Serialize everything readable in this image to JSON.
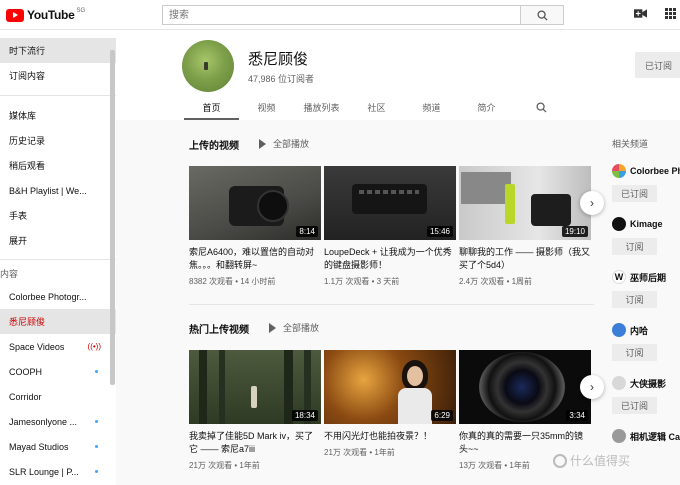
{
  "header": {
    "logo_text": "YouTube",
    "region": "SG",
    "search_placeholder": "搜索"
  },
  "sidebar": {
    "items_top": [
      {
        "label": "时下流行",
        "active": true
      },
      {
        "label": "订阅内容"
      }
    ],
    "items_library": [
      {
        "label": "媒体库"
      },
      {
        "label": "历史记录"
      },
      {
        "label": "稍后观看"
      },
      {
        "label": "B&H Playlist | We..."
      },
      {
        "label": "手表"
      },
      {
        "label": "展开"
      }
    ],
    "subscriptions_heading": "内容",
    "subscriptions": [
      {
        "label": "Colorbee Photogr..."
      },
      {
        "label": "悉尼顾俊"
      },
      {
        "label": "Space Videos"
      },
      {
        "label": "COOPH"
      },
      {
        "label": "Corridor"
      },
      {
        "label": "Jamesonlyone ..."
      },
      {
        "label": "Mayad Studios"
      },
      {
        "label": "SLR Lounge | P..."
      }
    ]
  },
  "channel": {
    "name": "悉尼顾俊",
    "subscribers": "47,986 位订阅者",
    "subscribed_label": "已订阅",
    "tabs": [
      "首页",
      "视频",
      "播放列表",
      "社区",
      "频道",
      "简介"
    ]
  },
  "sections": [
    {
      "title": "上传的视频",
      "play_all": "全部播放",
      "videos": [
        {
          "title": "索尼A6400，难以置信的自动对焦。。。和翻转屏~",
          "meta": "8382 次观看 • 14 小时前",
          "duration": "8:14"
        },
        {
          "title": "LoupeDeck + 让我成为一个优秀的键盘摄影师！",
          "meta": "1.1万 次观看 • 3 天前",
          "duration": "15:46"
        },
        {
          "title": "聊聊我的工作 —— 摄影师（我又买了个5d4）",
          "meta": "2.4万 次观看 • 1周前",
          "duration": "19:10"
        }
      ]
    },
    {
      "title": "热门上传视频",
      "play_all": "全部播放",
      "videos": [
        {
          "title": "我卖掉了佳能5D Mark iv，买了它 —— 索尼a7iii",
          "meta": "21万 次观看 • 1年前",
          "duration": "18:34"
        },
        {
          "title": "不用闪光灯也能拍夜景？！",
          "meta": "21万 次观看 • 1年前",
          "duration": "6:29"
        },
        {
          "title": "你真的真的需要一只35mm的镜头~~",
          "meta": "13万 次观看 • 1年前",
          "duration": "3:34"
        }
      ]
    }
  ],
  "related": {
    "title": "相关频道",
    "channels": [
      {
        "name": "Colorbee Pho",
        "button": "已订阅",
        "color": "#f4a52a"
      },
      {
        "name": "Kimage",
        "button": "订阅",
        "color": "#111111"
      },
      {
        "name": "巫师后期",
        "button": "订阅",
        "color": "#ffffff"
      },
      {
        "name": "内哈",
        "button": "订阅",
        "color": "#3b7fd8"
      },
      {
        "name": "大侠摄影",
        "button": "已订阅",
        "color": "#d8d8d8"
      },
      {
        "name": "相机逻辑 Car",
        "button": "",
        "color": "#999999"
      }
    ]
  },
  "watermark": "什么值得买"
}
